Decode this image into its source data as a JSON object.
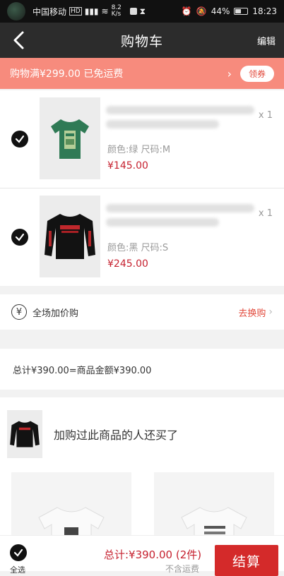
{
  "status_bar": {
    "carrier": "中国移动",
    "net_badge": "HD",
    "speed": "8.2 K/s",
    "battery": "44%",
    "time": "18:23"
  },
  "nav": {
    "title": "购物车",
    "edit_label": "编辑"
  },
  "free_shipping": {
    "text": "购物满¥299.00 已免运费",
    "coupon_label": "领券"
  },
  "items": [
    {
      "qty": "x 1",
      "spec": "颜色:绿   尺码:M",
      "price": "¥145.00",
      "shirt_color": "#2f7a55"
    },
    {
      "qty": "x 1",
      "spec": "颜色:黑   尺码:S",
      "price": "¥245.00",
      "shirt_color": "#121212"
    }
  ],
  "addon": {
    "icon": "yen-circle-icon",
    "label": "全场加价购",
    "action": "去换购"
  },
  "summary": {
    "text": "总计¥390.00=商品金额¥390.00"
  },
  "recommend": {
    "title": "加购过此商品的人还买了"
  },
  "bottom": {
    "select_all": "全选",
    "total": "总计:¥390.00 (2件)",
    "shipping_note": "不含运费",
    "checkout_label": "结算"
  },
  "colors": {
    "accent_red": "#c6212f",
    "banner": "#f78b7d",
    "nav_bg": "#2c2c2c"
  }
}
